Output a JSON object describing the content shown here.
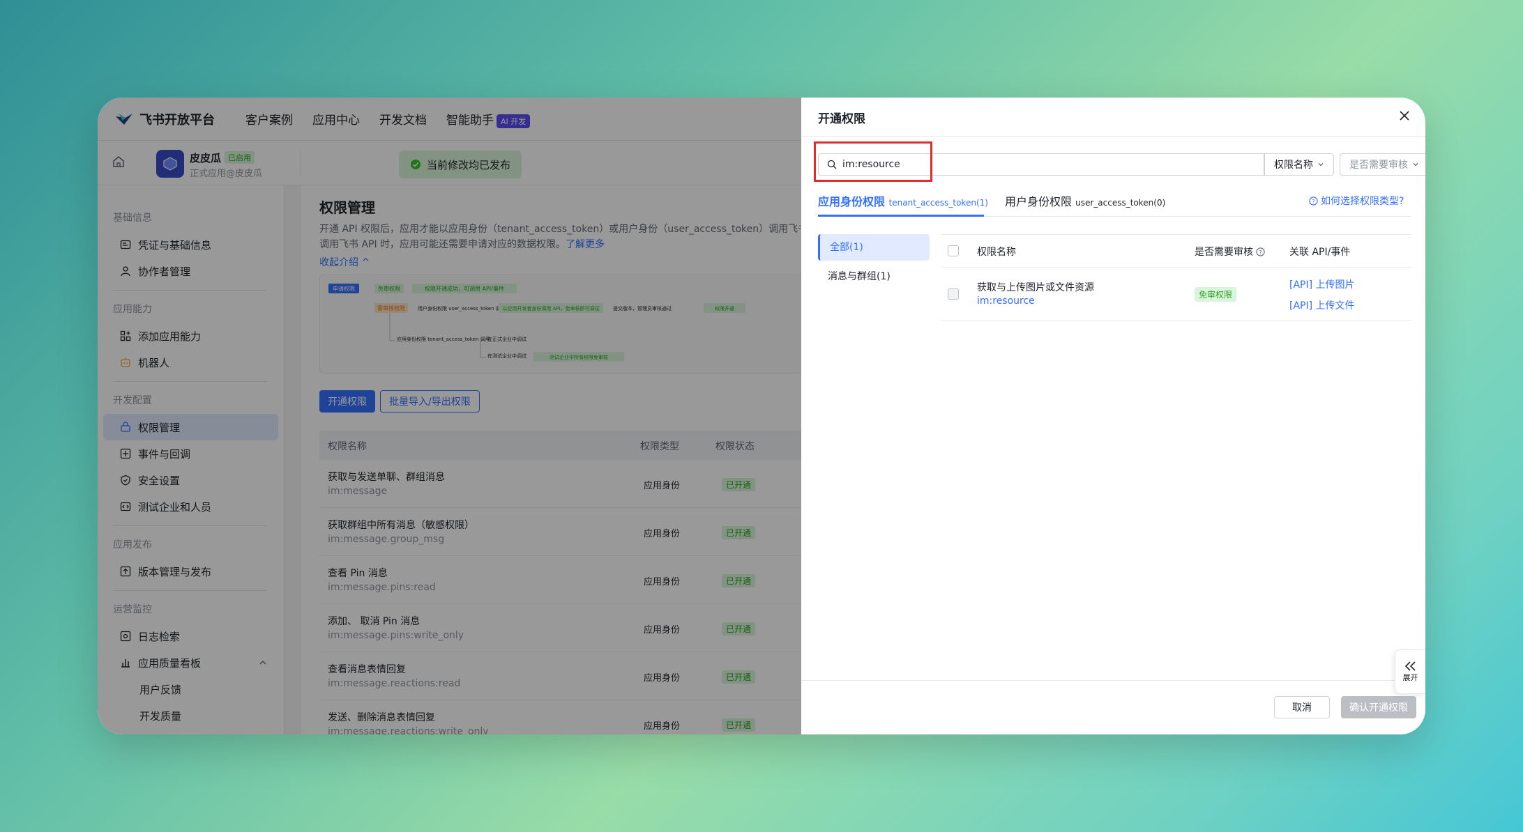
{
  "topnav": {
    "logo_text": "飞书开放平台",
    "items": [
      "客户案例",
      "应用中心",
      "开发文档",
      "智能助手"
    ],
    "ai_badge": "AI 开发"
  },
  "app": {
    "name": "皮皮瓜",
    "status": "已启用",
    "subtitle": "正式应用@皮皮瓜",
    "published_notice": "当前修改均已发布"
  },
  "sidebar": {
    "sections": [
      {
        "title": "基础信息",
        "items": [
          "凭证与基础信息",
          "协作者管理"
        ]
      },
      {
        "title": "应用能力",
        "items": [
          "添加应用能力",
          "机器人"
        ]
      },
      {
        "title": "开发配置",
        "items": [
          "权限管理",
          "事件与回调",
          "安全设置",
          "测试企业和人员"
        ]
      },
      {
        "title": "应用发布",
        "items": [
          "版本管理与发布"
        ]
      },
      {
        "title": "运营监控",
        "items": [
          "日志检索",
          "应用质量看板"
        ]
      }
    ],
    "subitems": [
      "用户反馈",
      "开发质量"
    ],
    "active": "权限管理"
  },
  "main": {
    "title": "权限管理",
    "desc_line1": "开通 API 权限后，应用才能以应用身份（tenant_access_token）或用户身份（user_access_token）调用飞书 A",
    "desc_line2": "调用飞书 API 时，应用可能还需要申请对应的数据权限。",
    "learn_more": "了解更多",
    "collapse": "收起介绍",
    "btn_open": "开通权限",
    "btn_batch": "批量导入/导出权限",
    "table_headers": [
      "权限名称",
      "权限类型",
      "权限状态"
    ],
    "rows": [
      {
        "name": "获取与发送单聊、群组消息",
        "code": "im:message",
        "type": "应用身份",
        "status": "已开通"
      },
      {
        "name": "获取群组中所有消息（敏感权限）",
        "code": "im:message.group_msg",
        "type": "应用身份",
        "status": "已开通"
      },
      {
        "name": "查看 Pin 消息",
        "code": "im:message.pins:read",
        "type": "应用身份",
        "status": "已开通"
      },
      {
        "name": "添加、 取消 Pin 消息",
        "code": "im:message.pins:write_only",
        "type": "应用身份",
        "status": "已开通"
      },
      {
        "name": "查看消息表情回复",
        "code": "im:message.reactions:read",
        "type": "应用身份",
        "status": "已开通"
      },
      {
        "name": "发送、删除消息表情回复",
        "code": "im:message.reactions:write_only",
        "type": "应用身份",
        "status": "已开通"
      }
    ]
  },
  "diagram": {
    "apply": "申请权限",
    "free": "免审权限",
    "free_done": "权限开通成功，可调用 API/事件",
    "review": "需审核权限",
    "user_identity": "用户身份权限 user_access_token 调用",
    "user_step": "以应用开发者身份调用 API，免审核即可调试",
    "submit": "提交版本，管理员审核通过",
    "last": "权限开通",
    "app_identity": "应用身份权限 tenant_access_token 调用",
    "formal": "在正式企业中调试",
    "test": "在测试企业中调试",
    "test_step": "测试企业中所有权限免审核"
  },
  "panel": {
    "title": "开通权限",
    "search_value": "im:resource",
    "select_name": "权限名称",
    "select_review": "是否需要审核",
    "tab_app": "应用身份权限",
    "tab_app_token": "tenant_access_token(1)",
    "tab_user": "用户身份权限",
    "tab_user_token": "user_access_token(0)",
    "howto": "如何选择权限类型?",
    "categories": [
      "全部(1)",
      "消息与群组(1)"
    ],
    "headers": {
      "name": "权限名称",
      "review": "是否需要审核",
      "api": "关联 API/事件"
    },
    "row": {
      "name": "获取与上传图片或文件资源",
      "code": "im:resource",
      "review": "免审权限",
      "apis": [
        "[API] 上传图片",
        "[API] 上传文件"
      ]
    },
    "cancel": "取消",
    "confirm": "确认开通权限",
    "expand": "展开"
  }
}
